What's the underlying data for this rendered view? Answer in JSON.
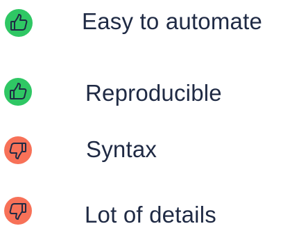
{
  "items": [
    {
      "label": "Easy to automate",
      "icon": "thumbs-up-icon",
      "color": "#2fc764"
    },
    {
      "label": "Reproducible",
      "icon": "thumbs-up-icon",
      "color": "#2fc764"
    },
    {
      "label": "Syntax",
      "icon": "thumbs-down-icon",
      "color": "#f77158"
    },
    {
      "label": "Lot of details",
      "icon": "thumbs-down-icon",
      "color": "#f77158"
    }
  ],
  "text_color": "#1f2a44"
}
